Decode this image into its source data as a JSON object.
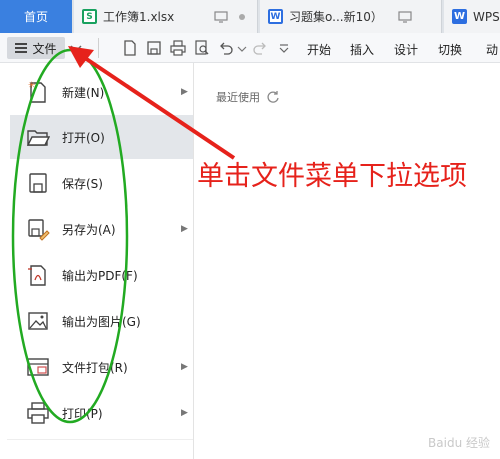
{
  "tabs": {
    "home": "首页",
    "doc1": "工作簿1.xlsx",
    "doc2": "习题集o...新10）",
    "doc3": "WPS"
  },
  "toolbar": {
    "file_label": "文件",
    "ribbon": [
      "开始",
      "插入",
      "设计",
      "切换",
      "动"
    ]
  },
  "file_menu": {
    "items": [
      {
        "label": "新建(N)",
        "icon": "new-doc-icon",
        "submenu": true
      },
      {
        "label": "打开(O)",
        "icon": "folder-open-icon",
        "submenu": false,
        "active": true
      },
      {
        "label": "保存(S)",
        "icon": "save-icon",
        "submenu": false
      },
      {
        "label": "另存为(A)",
        "icon": "save-as-icon",
        "submenu": true
      },
      {
        "label": "输出为PDF(F)",
        "icon": "export-pdf-icon",
        "submenu": false
      },
      {
        "label": "输出为图片(G)",
        "icon": "export-image-icon",
        "submenu": false
      },
      {
        "label": "文件打包(R)",
        "icon": "package-icon",
        "submenu": true
      },
      {
        "label": "打印(P)",
        "icon": "printer-icon",
        "submenu": true
      }
    ]
  },
  "recent": {
    "label": "最近使用"
  },
  "annotation": {
    "text": "单击文件菜单下拉选项"
  },
  "watermark": {
    "text": "Baidu 经验"
  },
  "colors": {
    "accent_blue": "#3a80e0",
    "annotation_red": "#e6221b",
    "circle_green": "#22aa22"
  }
}
